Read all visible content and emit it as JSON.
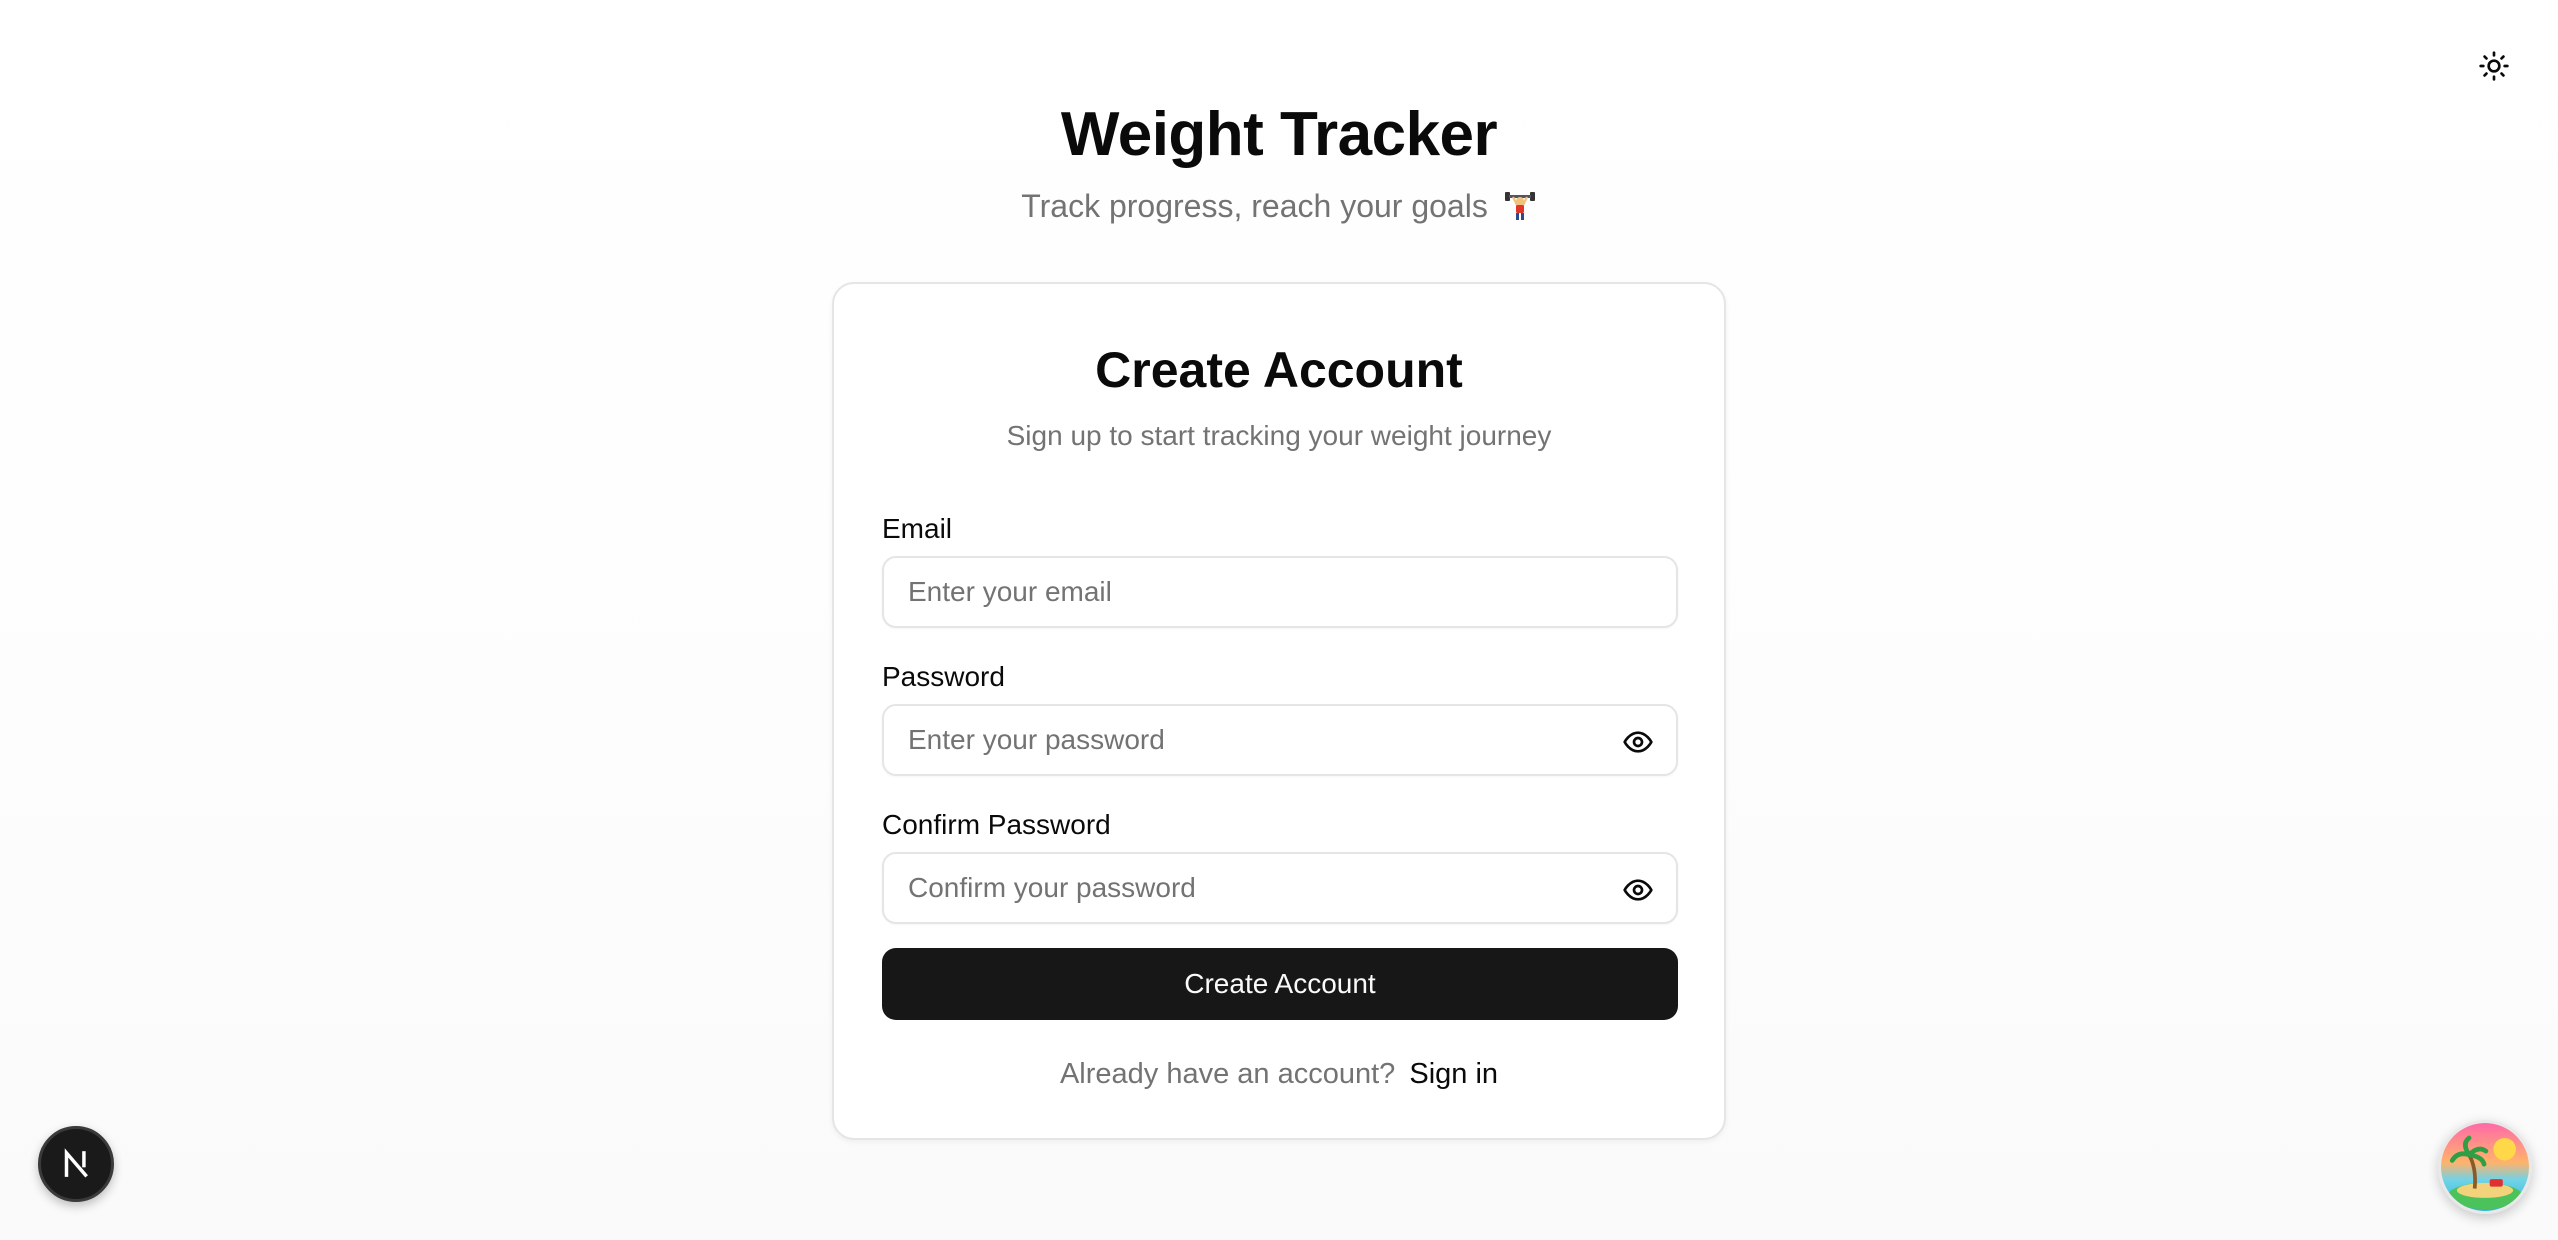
{
  "header": {
    "title": "Weight Tracker",
    "subtitle": "Track progress, reach your goals"
  },
  "theme_toggle": {
    "icon": "sun-icon"
  },
  "card": {
    "title": "Create Account",
    "description": "Sign up to start tracking your weight journey",
    "email": {
      "label": "Email",
      "placeholder": "Enter your email",
      "value": ""
    },
    "password": {
      "label": "Password",
      "placeholder": "Enter your password",
      "value": "",
      "toggle_icon": "eye-icon"
    },
    "confirm_password": {
      "label": "Confirm Password",
      "placeholder": "Confirm your password",
      "value": "",
      "toggle_icon": "eye-icon"
    },
    "submit_label": "Create Account",
    "signin_prompt": "Already have an account?",
    "signin_link": "Sign in"
  },
  "dev_indicator": {
    "letter": "N",
    "icon": "nextjs-logo-icon"
  },
  "floating_widget": {
    "icon": "tropical-island-icon"
  },
  "colors": {
    "primary": "#171717",
    "primary_text": "#fafafa",
    "muted_text": "#737373",
    "border": "#e5e5e5",
    "foreground": "#0a0a0a"
  }
}
